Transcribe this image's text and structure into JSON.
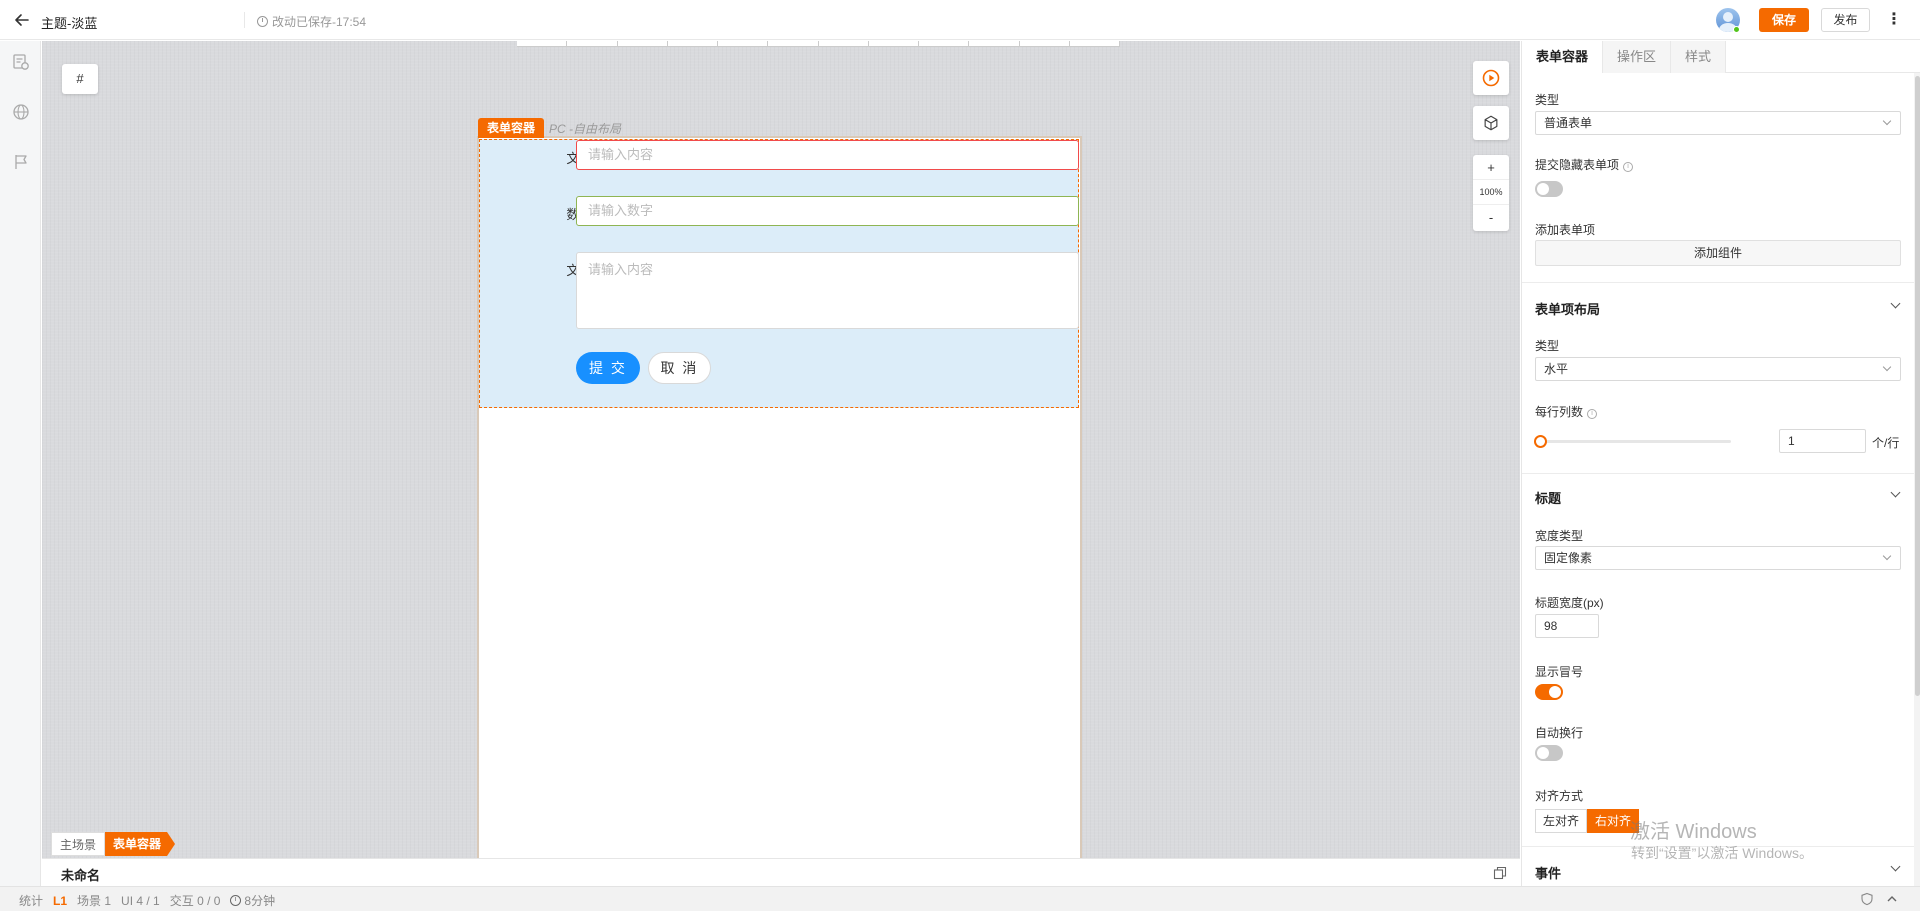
{
  "header": {
    "title": "主题-淡蓝",
    "saved_text": "改动已保存-17:54",
    "save_label": "保存",
    "publish_label": "发布"
  },
  "canvas": {
    "hash_label": "#",
    "zoom_in": "+",
    "zoom_level": "100%",
    "zoom_out": "-"
  },
  "form": {
    "tag": "表单容器",
    "hint": "PC -自由布局",
    "fields": [
      {
        "label": "文本框:",
        "placeholder": "请输入内容"
      },
      {
        "label": "数字框:",
        "placeholder": "请输入数字"
      },
      {
        "label": "文本域:",
        "placeholder": "请输入内容"
      }
    ],
    "submit_label": "提 交",
    "cancel_label": "取 消"
  },
  "breadcrumb": [
    "主场景",
    "表单容器"
  ],
  "scene": {
    "name": "未命名"
  },
  "status": {
    "stats_label": "统计",
    "level": "L1",
    "scene": "场景 1",
    "ui": "UI 4 / 1",
    "interaction": "交互 0 / 0",
    "time": "8分钟"
  },
  "panel": {
    "tabs": [
      "表单容器",
      "操作区",
      "样式"
    ],
    "type_label": "类型",
    "type_value": "普通表单",
    "hide_items_label": "提交隐藏表单项",
    "add_item_label": "添加表单项",
    "add_component_label": "添加组件",
    "layout_section": "表单项布局",
    "layout_type_label": "类型",
    "layout_type_value": "水平",
    "columns_label": "每行列数",
    "columns_value": "1",
    "columns_unit": "个/行",
    "columns_slider_fraction": 0,
    "title_section": "标题",
    "width_type_label": "宽度类型",
    "width_type_value": "固定像素",
    "title_width_label": "标题宽度(px)",
    "title_width_value": "98",
    "show_colon_label": "显示冒号",
    "auto_wrap_label": "自动换行",
    "align_label": "对齐方式",
    "align_left": "左对齐",
    "align_right": "右对齐",
    "event_section": "事件"
  },
  "watermark": {
    "line1": "激活 Windows",
    "line2": "转到“设置”以激活 Windows。"
  },
  "colors": {
    "accent": "#f56a00",
    "primary": "#1890ff",
    "form_bg": "#dcedf9"
  }
}
